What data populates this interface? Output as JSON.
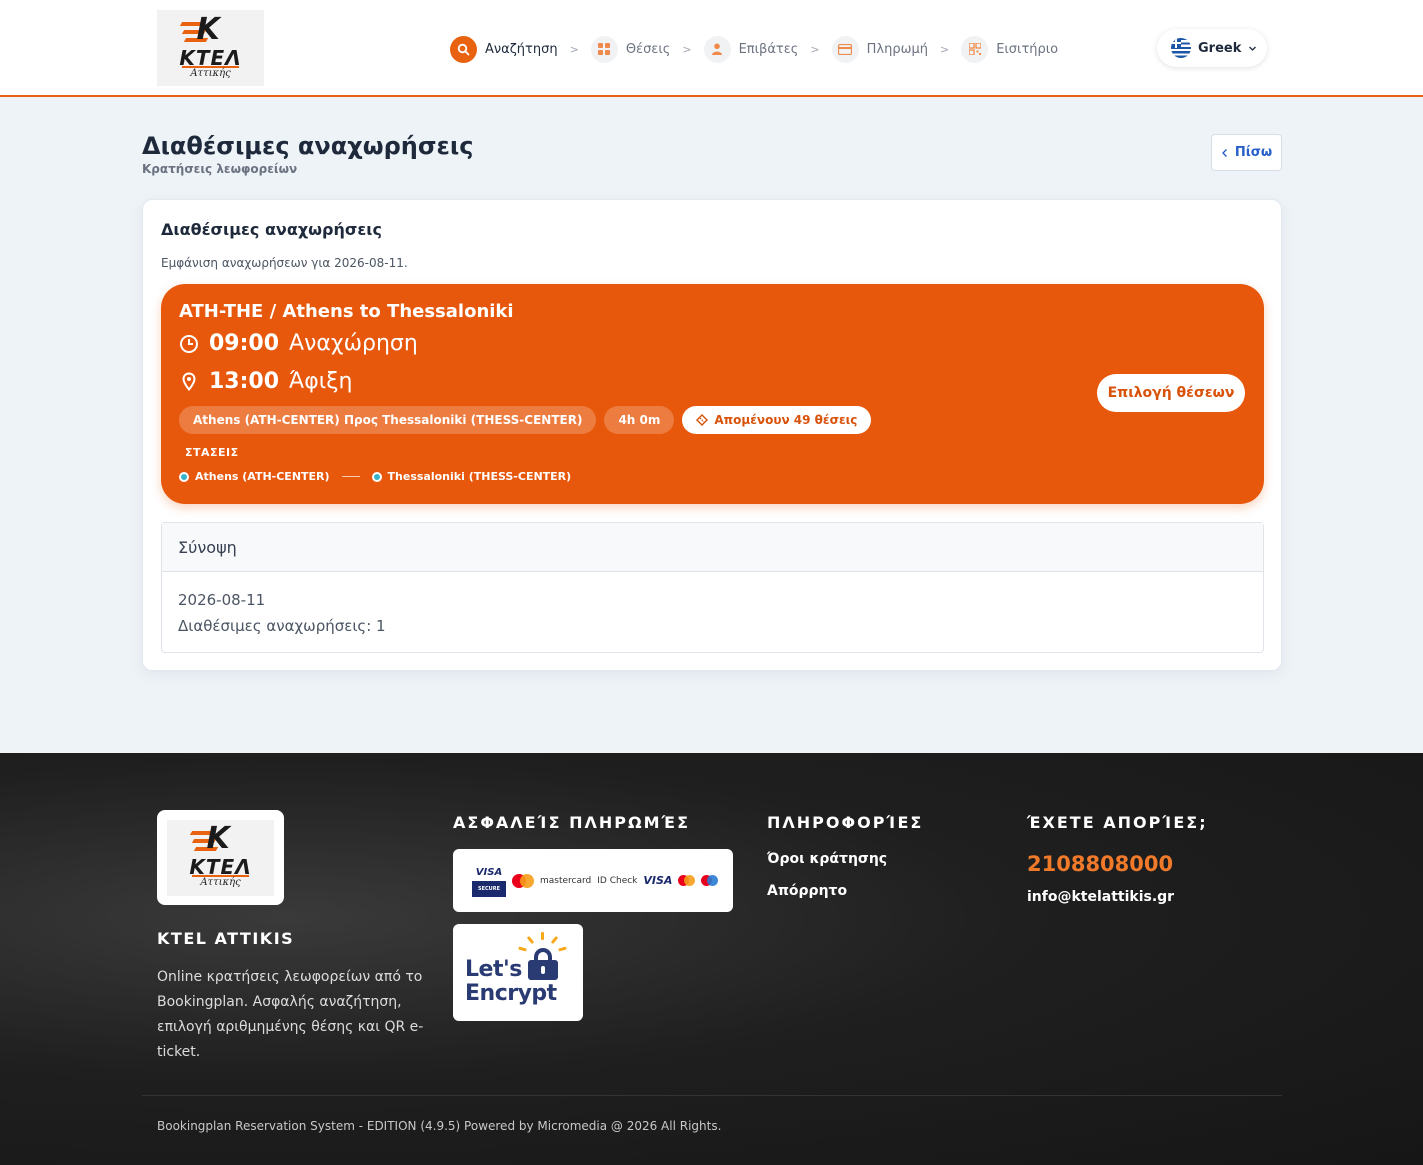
{
  "header": {
    "logo": {
      "text": "ΚΤΕΛ",
      "sub": "Αττικής"
    },
    "steps": [
      {
        "label": "Αναζήτηση",
        "icon": "search-icon",
        "active": true
      },
      {
        "label": "Θέσεις",
        "icon": "grid-icon",
        "active": false
      },
      {
        "label": "Επιβάτες",
        "icon": "user-icon",
        "active": false
      },
      {
        "label": "Πληρωμή",
        "icon": "card-icon",
        "active": false
      },
      {
        "label": "Εισιτήριο",
        "icon": "qr-icon",
        "active": false
      }
    ],
    "step_separator": ">",
    "language": "Greek"
  },
  "page": {
    "title": "Διαθέσιμες αναχωρήσεις",
    "subtitle": "Κρατήσεις λεωφορείων",
    "back_label": "Πίσω"
  },
  "card": {
    "title": "Διαθέσιμες αναχωρήσεις",
    "note": "Εμφάνιση αναχωρήσεων για 2026-08-11.",
    "departure": {
      "route": "ATH-THE / Athens to Thessaloniki",
      "departure_time": "09:00",
      "departure_label": "Αναχώρηση",
      "arrival_time": "13:00",
      "arrival_label": "Άφιξη",
      "route_chip": "Athens (ATH-CENTER) Προς Thessaloniki (THESS-CENTER)",
      "duration_chip": "4h 0m",
      "seats_chip": "Απομένουν 49 θέσεις",
      "stops_heading": "ΣΤΑΣΕΙΣ",
      "stops": [
        "Athens (ATH-CENTER)",
        "Thessaloniki (THESS-CENTER)"
      ],
      "select_label": "Επιλογή θέσεων"
    },
    "summary": {
      "heading": "Σύνοψη",
      "date": "2026-08-11",
      "count_text": "Διαθέσιμες αναχωρήσεις: 1"
    }
  },
  "footer": {
    "brand": "KTEL ATTIKIS",
    "description": "Online κρατήσεις λεωφορείων από το Bookingplan. Ασφαλής αναζήτηση, επιλογή αριθμημένης θέσης και QR e-ticket.",
    "payments_heading": "ΑΣΦΑΛΕΊΣ ΠΛΗΡΩΜΈΣ",
    "payment_badges": {
      "visa": "VISA",
      "secure": "SECURE",
      "mastercard": "mastercard",
      "idcheck": "ID Check",
      "visa2": "VISA"
    },
    "letsencrypt": {
      "line1": "Let's",
      "line2": "Encrypt"
    },
    "info_heading": "ΠΛΗΡΟΦΟΡΊΕΣ",
    "links": [
      "Όροι κράτησης",
      "Απόρρητο"
    ],
    "contact_heading": "ΈΧΕΤΕ ΑΠΟΡΊΕΣ;",
    "phone": "2108808000",
    "email": "info@ktelattikis.gr",
    "copyright": "Bookingplan Reservation System - EDITION (4.9.5) Powered by Micromedia @ 2026 All Rights."
  },
  "colors": {
    "accent": "#e8580c",
    "link": "#2760c9",
    "footer_bg": "#1f1f1f",
    "phone": "#f07a2a"
  }
}
